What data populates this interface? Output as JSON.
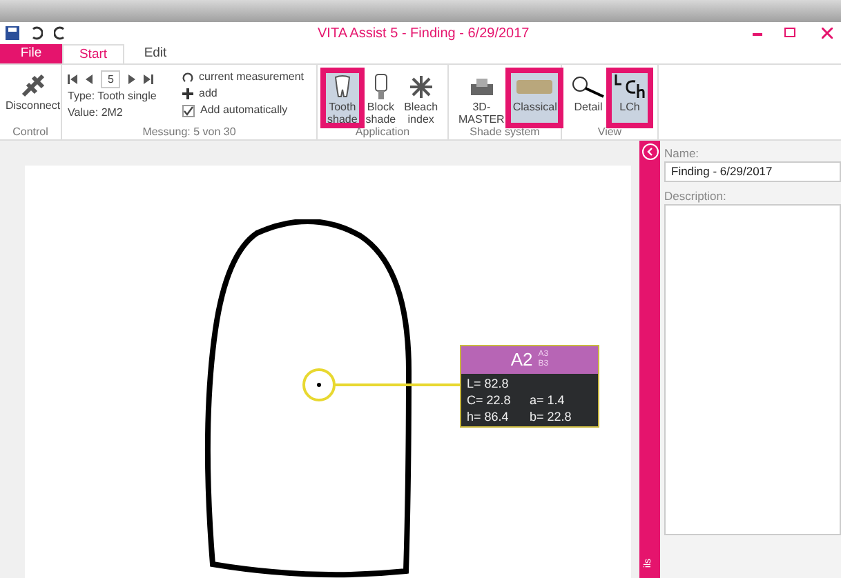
{
  "window": {
    "title": "VITA Assist 5 - Finding - 6/29/2017"
  },
  "tabs": [
    {
      "label": "File",
      "kind": "file",
      "selected": false
    },
    {
      "label": "Start",
      "kind": "tab",
      "selected": true
    },
    {
      "label": "Edit",
      "kind": "tab",
      "selected": false
    }
  ],
  "ribbon": {
    "control": {
      "button": "Disconnect",
      "group": "Control"
    },
    "measurement": {
      "index": "5",
      "type": "Type:  Tooth single",
      "value": "Value: 2M2",
      "current": "current measurement",
      "add": "add",
      "auto": {
        "label": "Add automatically",
        "checked": true
      },
      "group": "Messung: 5 von 30"
    },
    "application": {
      "group": "Application",
      "buttons": [
        {
          "label": "Tooth shade",
          "selected": true
        },
        {
          "label": "Block shade",
          "selected": false
        },
        {
          "label": "Bleach index",
          "selected": false
        }
      ]
    },
    "shade_system": {
      "group": "Shade system",
      "buttons": [
        {
          "label": "3D-MASTER",
          "selected": false
        },
        {
          "label": "Classical",
          "selected": true
        }
      ]
    },
    "view": {
      "group": "View",
      "buttons": [
        {
          "label": "Detail",
          "selected": false
        },
        {
          "label": "LCh",
          "selected": true
        }
      ]
    }
  },
  "shade_card": {
    "shade": "A2",
    "alt_1": "A3",
    "alt_2": "B3",
    "L": "L= 82.8",
    "C": "C= 22.8",
    "a": "a= 1.4",
    "h": "h= 86.4",
    "b": "b= 22.8"
  },
  "details_panel": {
    "tab": "ils",
    "name_label": "Name:",
    "name_value": "Finding - 6/29/2017",
    "description_label": "Description:"
  }
}
